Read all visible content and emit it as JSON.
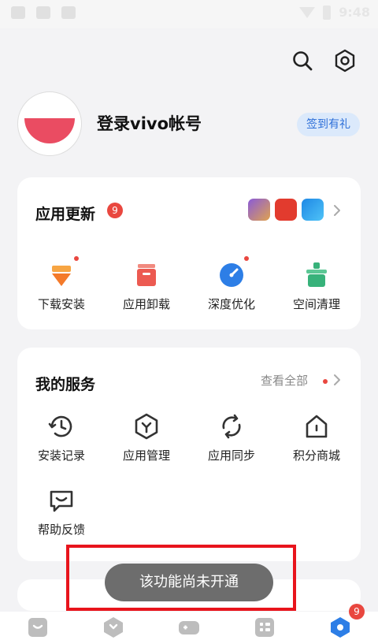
{
  "status_bar": {
    "time": "9:48"
  },
  "profile": {
    "login_text": "登录vivo帐号",
    "signin_label": "签到有礼"
  },
  "updates": {
    "title": "应用更新",
    "badge_count": "9",
    "tools": [
      {
        "label": "下载安装"
      },
      {
        "label": "应用卸载"
      },
      {
        "label": "深度优化"
      },
      {
        "label": "空间清理"
      }
    ]
  },
  "services": {
    "title": "我的服务",
    "view_all": "查看全部",
    "items": [
      {
        "label": "安装记录"
      },
      {
        "label": "应用管理"
      },
      {
        "label": "应用同步"
      },
      {
        "label": "积分商城"
      },
      {
        "label": "帮助反馈"
      }
    ]
  },
  "toast": {
    "message": "该功能尚未开通"
  },
  "bottom_nav": {
    "badge_count": "9"
  },
  "colors": {
    "accent_blue": "#2d6fd8",
    "badge_red": "#e9473f",
    "highlight_red": "#e8141c"
  }
}
